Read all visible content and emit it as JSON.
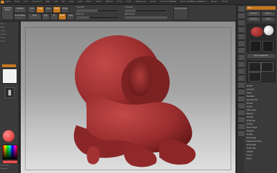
{
  "app": {
    "title": "ZBrush 3.5",
    "window_title": "ZBrush Document",
    "menus": [
      "Alpha",
      "Brush",
      "Color",
      "Document",
      "Draw",
      "Edit",
      "File",
      "Layer",
      "Light",
      "Macro",
      "Marker",
      "Material",
      "Movie",
      "Picker",
      "Preferences",
      "Render",
      "Stencil",
      "Stroke",
      "Texture",
      "Tool",
      "Transform",
      "Zplugin",
      "Zscript"
    ]
  },
  "topbar": {
    "buttons": [
      "Projection Master",
      "LightBox",
      "Quick Sketch",
      "Edit",
      "Draw",
      "Move",
      "Scale",
      "Rotate"
    ],
    "active": [
      "Edit",
      "Draw"
    ],
    "sliders": [
      "Mrgb",
      "Rgb",
      "M",
      "Zadd",
      "Zsub",
      "Focal Shift",
      "Draw Size",
      "Z Intensity",
      "Rgb Intensity"
    ],
    "right_button": "Dynamic Persp"
  },
  "leftshelf": {
    "items": [
      "Tool",
      "Alpha",
      "Texture",
      "Material",
      "Stroke",
      "Brush",
      "Gradient",
      "SwitchColor",
      "Alternate"
    ]
  },
  "rightshelf": {
    "icons": [
      "BPR",
      "SPix",
      "Scroll",
      "Zoom",
      "Actual",
      "AAHalf",
      "Persp",
      "Floor",
      "Local",
      "Xyz",
      "Frame",
      "Move",
      "Scale",
      "Rotate",
      "PolyF",
      "Transp",
      "Ghost",
      "Solo",
      "Xpose"
    ]
  },
  "rightpanel": {
    "header": "Tool",
    "buttons": [
      "Load Tool",
      "Save As",
      "Copy Tool",
      "Import",
      "Export",
      "Clone",
      "Make PolyMesh3D"
    ],
    "subtool_list": [
      "SubTool",
      "Geometry",
      "Layers",
      "FiberMesh",
      "Geometry HD",
      "Preview",
      "Surface",
      "Deformation",
      "Masking",
      "Visibility",
      "Polygroups",
      "Contact",
      "Morph Target",
      "Polypaint",
      "UV Map",
      "Texture Map",
      "Displacement Map",
      "Normal Map",
      "Unified Skin",
      "Initialize",
      "Import",
      "Export"
    ]
  },
  "colors": {
    "accent": "#c77820",
    "model": "#9b2d2e",
    "panel_bg": "#3a3a3a",
    "swatch": "#e65050"
  }
}
